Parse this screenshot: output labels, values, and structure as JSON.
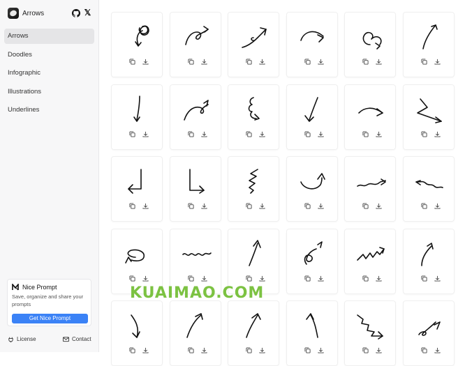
{
  "app": {
    "title": "Arrows"
  },
  "header": {
    "github_icon": "github-icon",
    "x_icon": "x-icon",
    "x_glyph": "𝕏"
  },
  "sidebar": {
    "items": [
      {
        "label": "Arrows",
        "active": true
      },
      {
        "label": "Doodles",
        "active": false
      },
      {
        "label": "Infographic",
        "active": false
      },
      {
        "label": "Illustrations",
        "active": false
      },
      {
        "label": "Underlines",
        "active": false
      }
    ]
  },
  "promo": {
    "title": "Nice Prompt",
    "text": "Save, organize and share your prompts",
    "button": "Get Nice Prompt"
  },
  "footer": {
    "license": "License",
    "contact": "Contact"
  },
  "watermark": "KUAIMAO.COM",
  "grid": {
    "columns": 6,
    "visible_rows": 5,
    "card_actions": [
      "copy-icon",
      "download-icon"
    ]
  }
}
